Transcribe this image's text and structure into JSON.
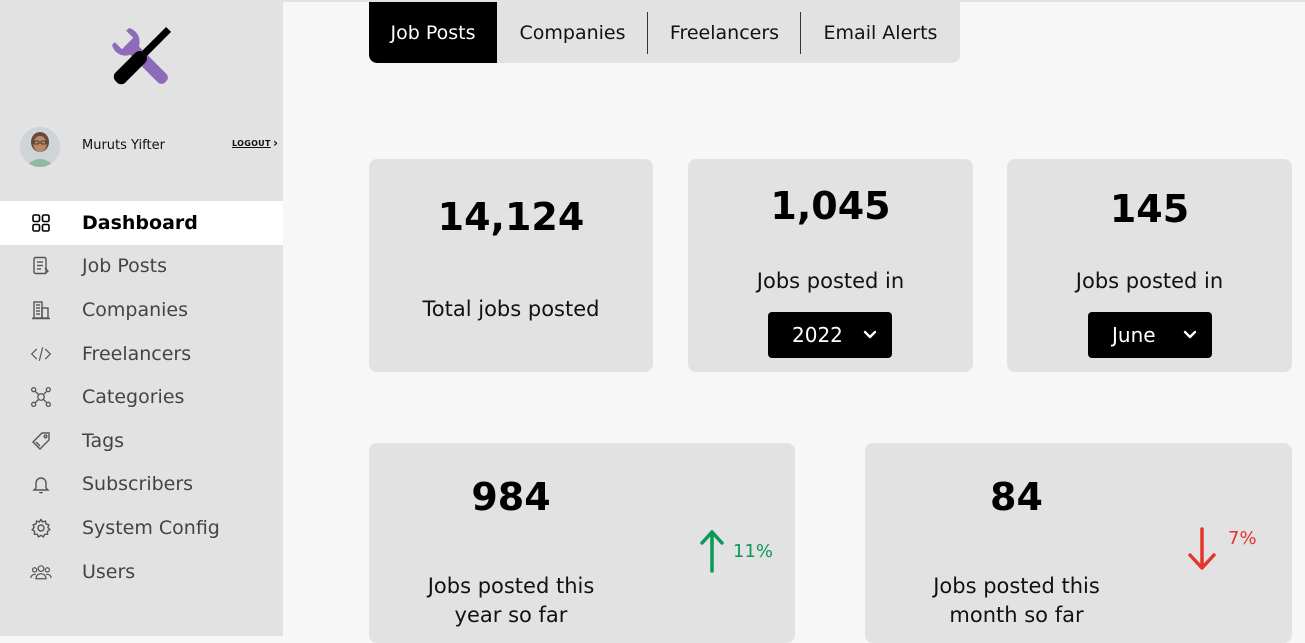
{
  "user": {
    "name": "Muruts Yifter",
    "logout_label": "LOGOUT",
    "logout_chevron": "›"
  },
  "sidebar": {
    "items": [
      {
        "label": "Dashboard",
        "icon": "dashboard-grid-icon",
        "active": true
      },
      {
        "label": "Job Posts",
        "icon": "document-list-icon"
      },
      {
        "label": "Companies",
        "icon": "building-icon"
      },
      {
        "label": "Freelancers",
        "icon": "code-icon"
      },
      {
        "label": "Categories",
        "icon": "network-icon"
      },
      {
        "label": "Tags",
        "icon": "tag-icon"
      },
      {
        "label": "Subscribers",
        "icon": "bell-icon"
      },
      {
        "label": "System Config",
        "icon": "gear-icon"
      },
      {
        "label": "Users",
        "icon": "users-icon"
      }
    ]
  },
  "tabs": [
    {
      "label": "Job Posts",
      "active": true
    },
    {
      "label": "Companies"
    },
    {
      "label": "Freelancers"
    },
    {
      "label": "Email Alerts"
    }
  ],
  "stats": {
    "total": {
      "value": "14,124",
      "caption": "Total jobs posted"
    },
    "year": {
      "value": "1,045",
      "caption": "Jobs posted in",
      "select_value": "2022"
    },
    "month": {
      "value": "145",
      "caption": "Jobs posted in",
      "select_value": "June"
    },
    "ytd": {
      "value": "984",
      "caption_line1": "Jobs posted this",
      "caption_line2": "year so far",
      "trend": "11%",
      "trend_direction": "up"
    },
    "mtd": {
      "value": "84",
      "caption_line1": "Jobs posted this",
      "caption_line2": "month so far",
      "trend": "7%",
      "trend_direction": "down"
    }
  },
  "colors": {
    "accent_purple": "#8e6bb8",
    "trend_up": "#0a9a55",
    "trend_down": "#e5342b",
    "card_bg": "#e2e2e2",
    "active_tab_bg": "#000000"
  }
}
